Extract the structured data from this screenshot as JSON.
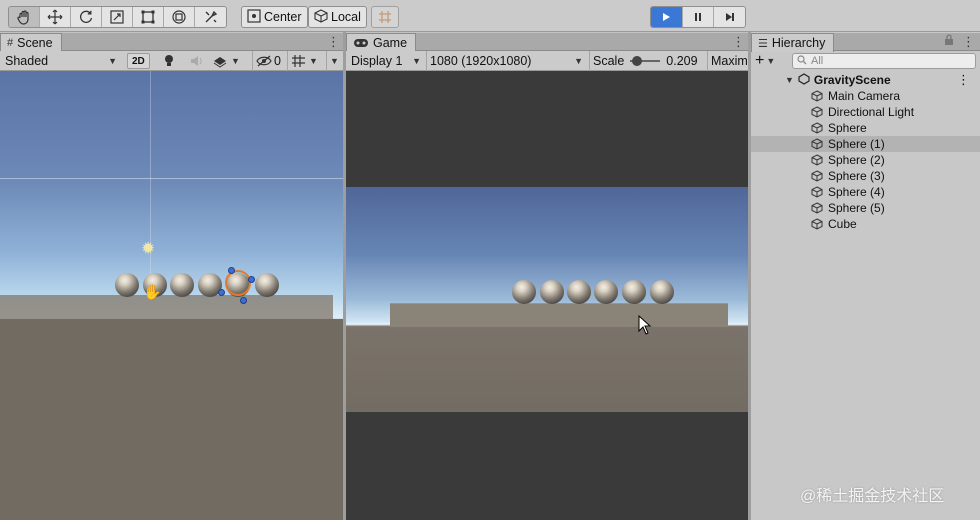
{
  "toolbar": {
    "tools": [
      "hand-tool",
      "move-tool",
      "rotate-tool",
      "scale-tool",
      "rect-tool",
      "transform-tool",
      "custom-tool"
    ],
    "pivot_label": "Center",
    "space_label": "Local"
  },
  "scene": {
    "tab_label": "Scene",
    "shading_mode": "Shaded",
    "mode_2d_label": "2D",
    "hidden_count": "0"
  },
  "game": {
    "tab_label": "Game",
    "display": "Display 1",
    "resolution": "1080 (1920x1080)",
    "scale_label": "Scale",
    "scale_value": "0.209",
    "maximize_label": "Maxim",
    "scale_slider_fraction": 0.1
  },
  "hierarchy": {
    "tab_label": "Hierarchy",
    "add_label": "+",
    "search_placeholder": "All",
    "scene_name": "GravityScene",
    "items": [
      {
        "label": "Main Camera"
      },
      {
        "label": "Directional Light"
      },
      {
        "label": "Sphere"
      },
      {
        "label": "Sphere (1)",
        "selected": true
      },
      {
        "label": "Sphere (2)"
      },
      {
        "label": "Sphere (3)"
      },
      {
        "label": "Sphere (4)"
      },
      {
        "label": "Sphere (5)"
      },
      {
        "label": "Cube"
      }
    ]
  },
  "watermark": "@稀土掘金技术社区"
}
